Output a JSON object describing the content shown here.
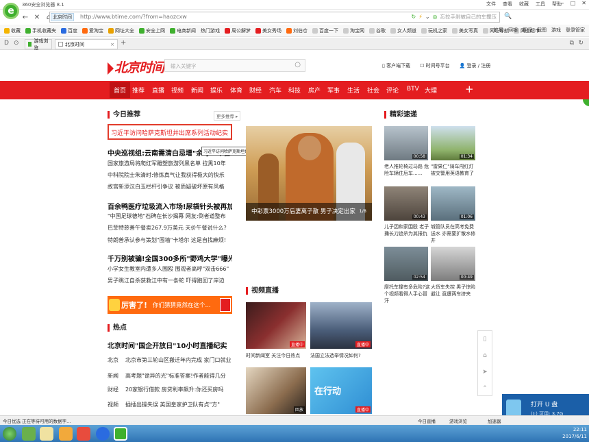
{
  "browser": {
    "title": "360安全浏览器 8.1",
    "menu": [
      "文件",
      "查看",
      "收藏",
      "工具",
      "帮助"
    ],
    "url_site_tag": "北京时间",
    "url": "http://www.btime.com/?from=haozcxw",
    "url_hint": "忘拉手刹被自己的车撞压",
    "bookmarks": [
      "收藏",
      "手机收藏夹",
      "百度",
      "爱淘宝",
      "网址大全",
      "安全上网",
      "电商新闻",
      "热门游戏",
      "周公解梦",
      "美女秀场",
      "刘伯仓",
      "百度一下",
      "淘宝网",
      "谷歌",
      "女人频道",
      "玩机之家",
      "美女写真",
      "网址导航",
      "网上超市"
    ],
    "bookmarks_right": [
      "扩展",
      "网银",
      "翻译",
      "截图",
      "游戏",
      "登录管家"
    ],
    "tabs": [
      "游戏浏览",
      "北京时间"
    ],
    "tab_add": "+"
  },
  "site": {
    "logo": "北京时间",
    "search_placeholder": "输入关键字",
    "top_links": [
      "客户端下载",
      "时间号平台",
      "登录 / 注册"
    ],
    "nav": [
      "首页",
      "推荐",
      "直播",
      "视频",
      "新闻",
      "娱乐",
      "体育",
      "财经",
      "汽车",
      "科技",
      "房产",
      "军事",
      "生活",
      "社会",
      "评论",
      "BTV",
      "大理"
    ],
    "nav_plus": "+",
    "today": {
      "title": "今日推荐",
      "more": "更多推荐 ▸",
      "highlight": "习近平访问哈萨克斯坦并出席系列活动纪实",
      "tooltip": "习近平访问哈萨克斯坦并出席系列活动纪实",
      "blocks": [
        {
          "headline": "中央巡视组:云南需清白忌增\"余毒\"\"不留",
          "lines": [
            "国家旅游局将爬红军雕塑旅游列黑名单 拉黑10年",
            "中科院院士朱清时:修炼真气让我获得极大的快乐",
            "故宫新添汉白玉栏杆引争议 被质疑破坏原有风格"
          ]
        },
        {
          "headline": "百余鸭医疗垃圾流入市场!尿袋针头被再加工",
          "lines": [
            "\"中国足球德地\"石碑在长沙揭幕 网友:倒者道整布",
            "巴菲特慈善午餐卖267.9万美元 天价午餐说什么?",
            "特朗普承认参与策划\"围墙\"卡塔尔 这是自找麻烦!"
          ]
        },
        {
          "headline": "千万别被骗!全国300多所\"野鸡大学\"曝光",
          "lines": [
            "小学女生教室内遭多人围殴 围观者高呼\"双击666\"",
            "男子跳江自杀获救江中有一条蛇 吓得跑回了岸边"
          ]
        }
      ]
    },
    "ad": {
      "big": "厉害了!",
      "small": "你们猜猜竟然在这个..."
    },
    "hot": {
      "title": "热点",
      "headline": "北京时间\"国企开放日\"10小时直播纪实",
      "rows": [
        {
          "cat": "北京",
          "text": "北京市第三轮山区搬迁年内完成 家门口就业"
        },
        {
          "cat": "新闻",
          "text": "高考题\"诡异的光\"标准答案!作者能得几分"
        },
        {
          "cat": "财经",
          "text": "20家银行借款 房贷利率飙升:你还买房吗"
        },
        {
          "cat": "视频",
          "text": "插插出操失误 英国皇家护卫队有点\"方\""
        }
      ]
    },
    "hero": {
      "caption": "中彩票3000万后妻离子散 男子决定出家",
      "page": "1/8"
    },
    "video_live": {
      "title": "视频直播",
      "items": [
        {
          "caption": "时间新闻室 关注今日热点",
          "badge": "直播中"
        },
        {
          "caption": "法国立法选举情况如何?",
          "badge": "直播中"
        },
        {
          "caption": "",
          "badge": "回放"
        },
        {
          "caption": "",
          "badge": "直播中",
          "overlay": "在行动"
        }
      ]
    },
    "jingcai": {
      "title": "精彩速递",
      "items": [
        {
          "dur": "00:58",
          "caption": "老人推轮椅过马路 危险车辆住后车......"
        },
        {
          "dur": "01:34",
          "caption": "\"雷果仁\"骑车闯红灯 被交警用英语教育了"
        },
        {
          "dur": "00:43",
          "caption": "儿子因和家围殴 老子捅长刀追杀为其报仇"
        },
        {
          "dur": "01:06",
          "caption": "城管队员在高考免费送水 亦需要扩散水修井"
        },
        {
          "dur": "02:54",
          "caption": "摩托车撞有多危险?这个视频看得人手心冒汗"
        },
        {
          "dur": "00:49",
          "caption": "大货车失控 男子惊险避让 竟遭两车挤夹"
        }
      ]
    }
  },
  "statusbar": {
    "left": "今日优选  正在等待可用的数据字...",
    "right": [
      "今日直播",
      "游戏浏览",
      "加速器"
    ]
  },
  "usb": {
    "title": "打开 U 盘",
    "sub": "(J:) 可用: 3.7G"
  },
  "taskbar": {
    "time": "22:11",
    "date": "2017/6/11"
  }
}
